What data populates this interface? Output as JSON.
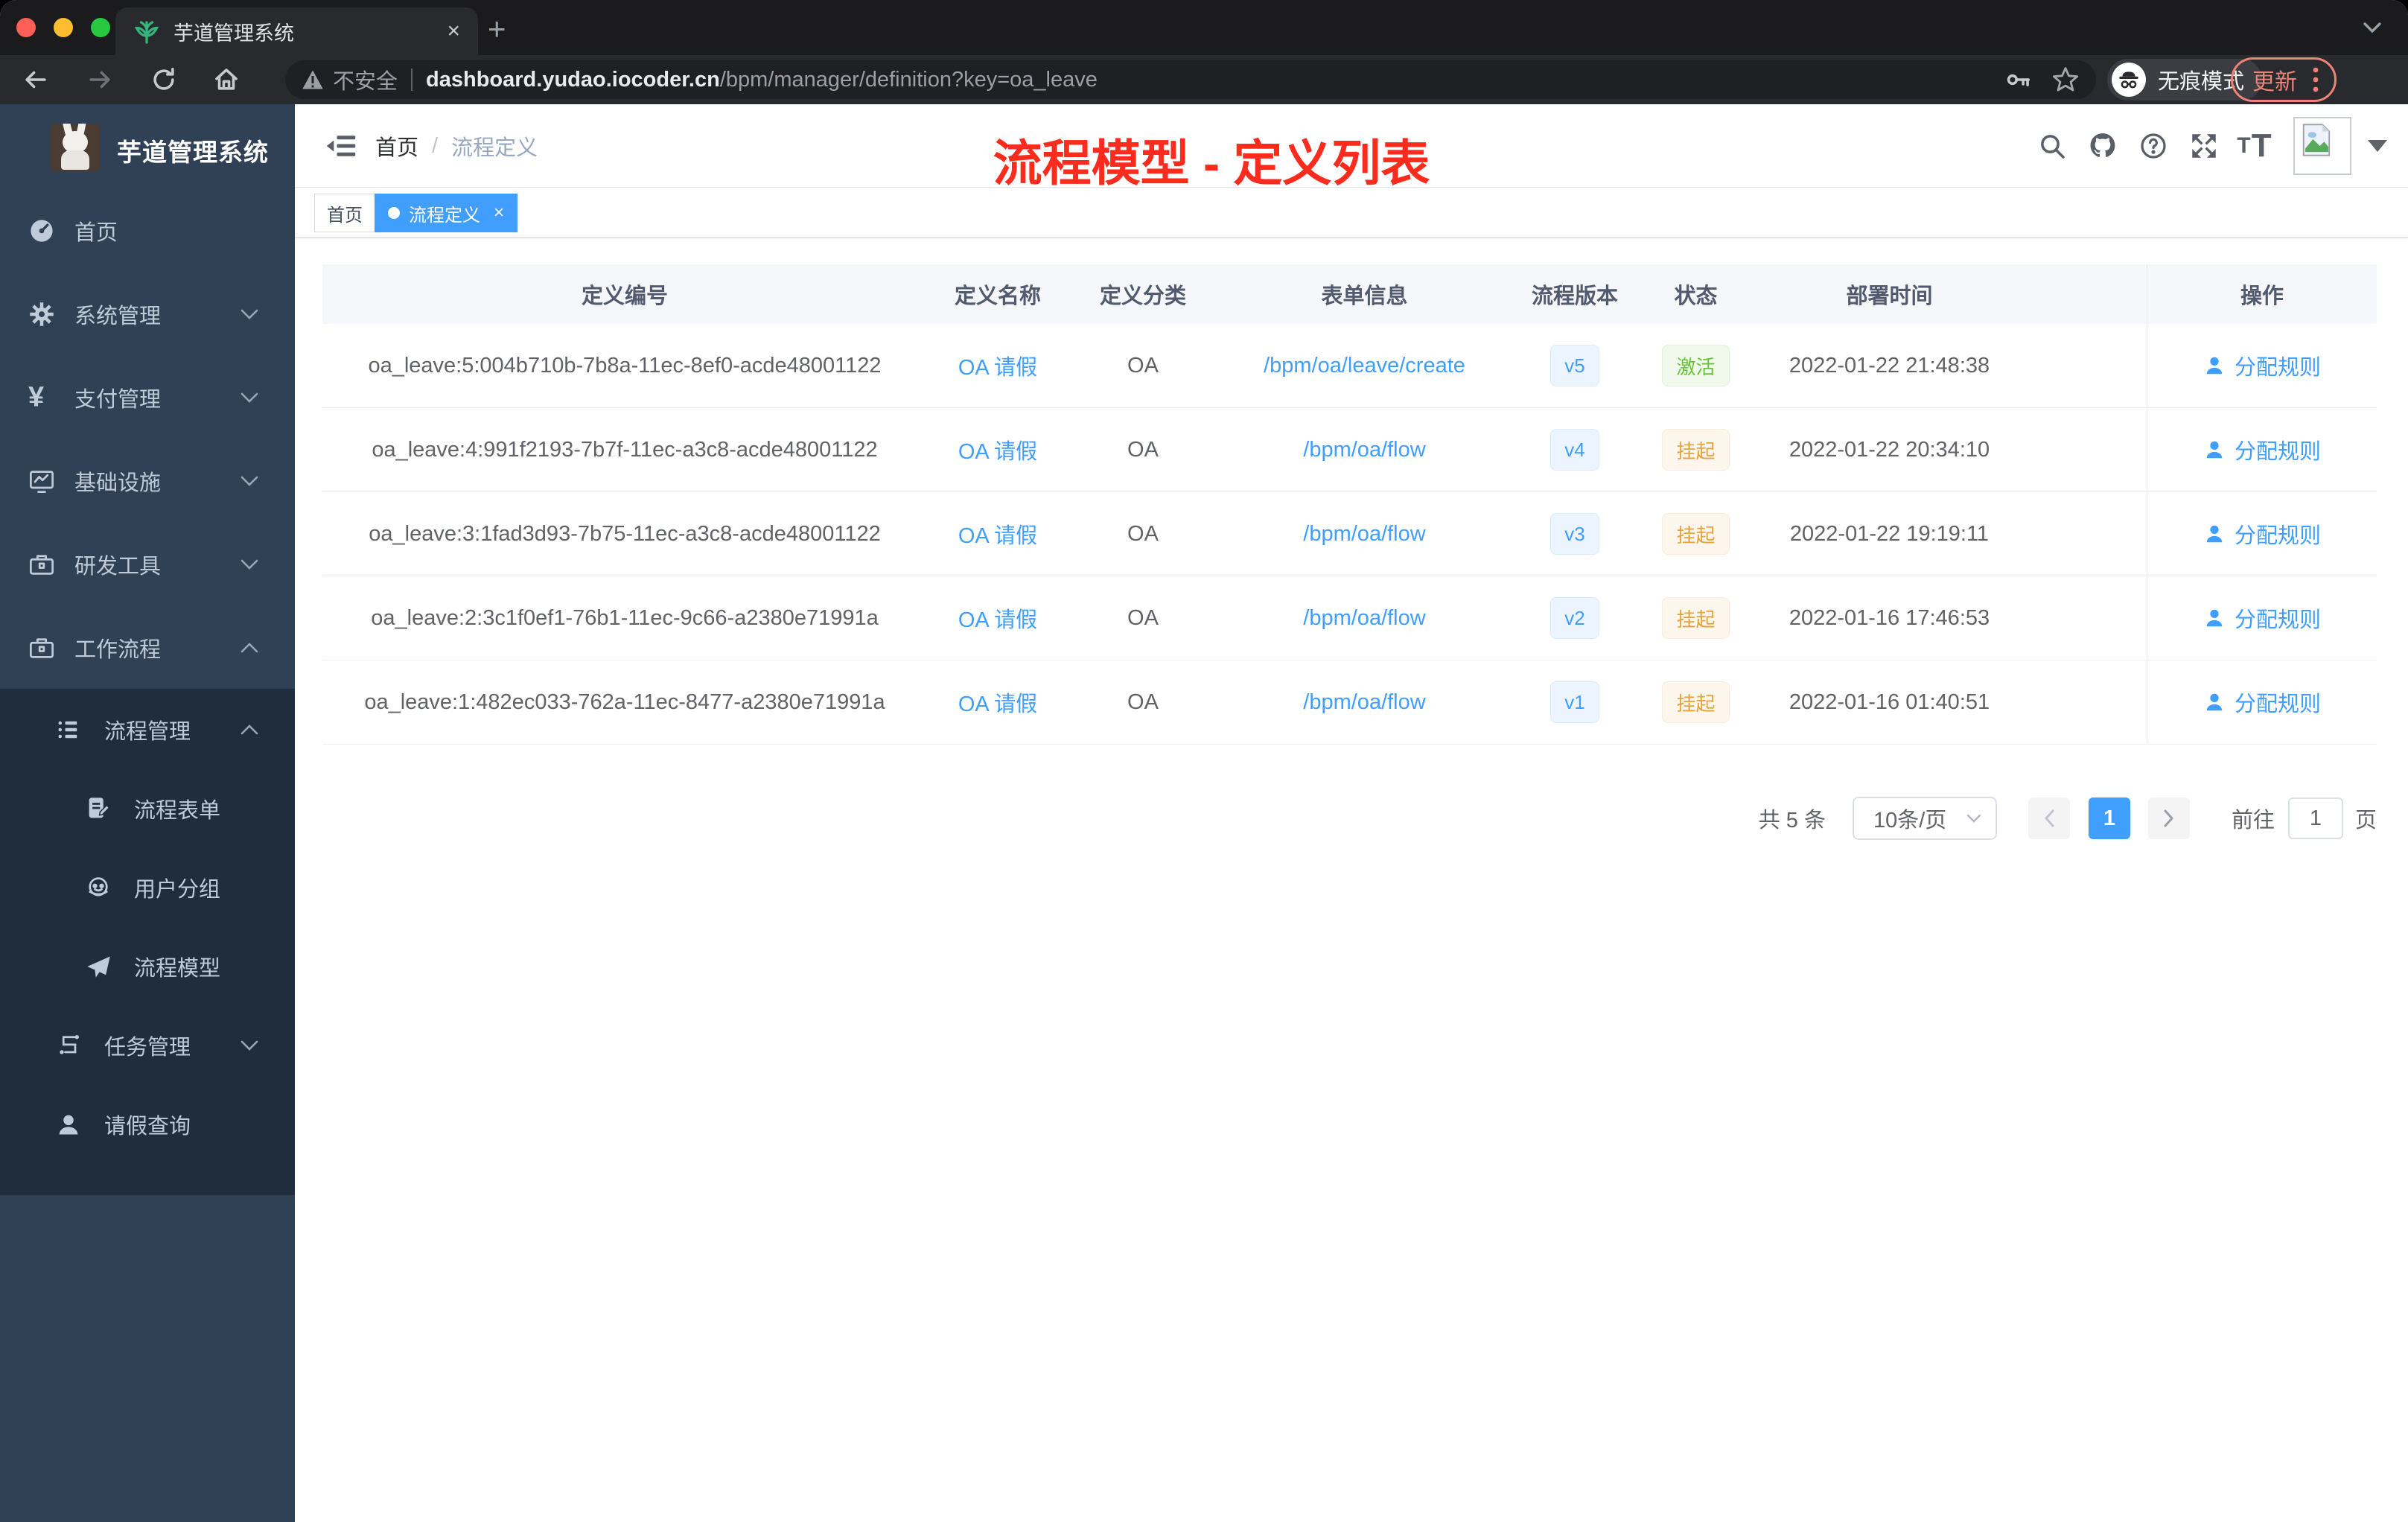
{
  "browser": {
    "tab_title": "芋道管理系统",
    "new_tab_label": "+",
    "security_label": "不安全",
    "url_host": "dashboard.yudao.iocoder.cn",
    "url_path": "/bpm/manager/definition?key=oa_leave",
    "incognito_label": "无痕模式",
    "update_label": "更新",
    "tab_close": "×"
  },
  "sidebar": {
    "app_title": "芋道管理系统",
    "items": {
      "home": "首页",
      "system": "系统管理",
      "payment": "支付管理",
      "infra": "基础设施",
      "devtools": "研发工具",
      "workflow": "工作流程",
      "process_mgmt": "流程管理",
      "process_form": "流程表单",
      "user_group": "用户分组",
      "process_model": "流程模型",
      "task_mgmt": "任务管理",
      "leave_query": "请假查询"
    }
  },
  "header": {
    "breadcrumb_home": "首页",
    "breadcrumb_sep": "/",
    "breadcrumb_current": "流程定义",
    "annotation": "流程模型 - 定义列表",
    "annotation_color": "#fb2b1d"
  },
  "tags": {
    "home": "首页",
    "active": "流程定义",
    "close": "×"
  },
  "table": {
    "columns": [
      "定义编号",
      "定义名称",
      "定义分类",
      "表单信息",
      "流程版本",
      "状态",
      "部署时间",
      "操作"
    ],
    "rows": [
      {
        "id": "oa_leave:5:004b710b-7b8a-11ec-8ef0-acde48001122",
        "name": "OA 请假",
        "category": "OA",
        "form": "/bpm/oa/leave/create",
        "version": "v5",
        "status": "激活",
        "status_type": "success",
        "deploy_time": "2022-01-22 21:48:38",
        "action": "分配规则"
      },
      {
        "id": "oa_leave:4:991f2193-7b7f-11ec-a3c8-acde48001122",
        "name": "OA 请假",
        "category": "OA",
        "form": "/bpm/oa/flow",
        "version": "v4",
        "status": "挂起",
        "status_type": "warning",
        "deploy_time": "2022-01-22 20:34:10",
        "action": "分配规则"
      },
      {
        "id": "oa_leave:3:1fad3d93-7b75-11ec-a3c8-acde48001122",
        "name": "OA 请假",
        "category": "OA",
        "form": "/bpm/oa/flow",
        "version": "v3",
        "status": "挂起",
        "status_type": "warning",
        "deploy_time": "2022-01-22 19:19:11",
        "action": "分配规则"
      },
      {
        "id": "oa_leave:2:3c1f0ef1-76b1-11ec-9c66-a2380e71991a",
        "name": "OA 请假",
        "category": "OA",
        "form": "/bpm/oa/flow",
        "version": "v2",
        "status": "挂起",
        "status_type": "warning",
        "deploy_time": "2022-01-16 17:46:53",
        "action": "分配规则"
      },
      {
        "id": "oa_leave:1:482ec033-762a-11ec-8477-a2380e71991a",
        "name": "OA 请假",
        "category": "OA",
        "form": "/bpm/oa/flow",
        "version": "v1",
        "status": "挂起",
        "status_type": "warning",
        "deploy_time": "2022-01-16 01:40:51",
        "action": "分配规则"
      }
    ]
  },
  "pagination": {
    "total": "共 5 条",
    "page_size": "10条/页",
    "current_page": "1",
    "goto_label": "前往",
    "goto_value": "1",
    "goto_unit": "页"
  },
  "colors": {
    "accent": "#409eff",
    "sidebar_bg": "#304156",
    "submenu_bg": "#1f2d3d",
    "success": "#67c23a",
    "warning": "#e6a23c",
    "annotation_red": "#fb2b1d"
  }
}
